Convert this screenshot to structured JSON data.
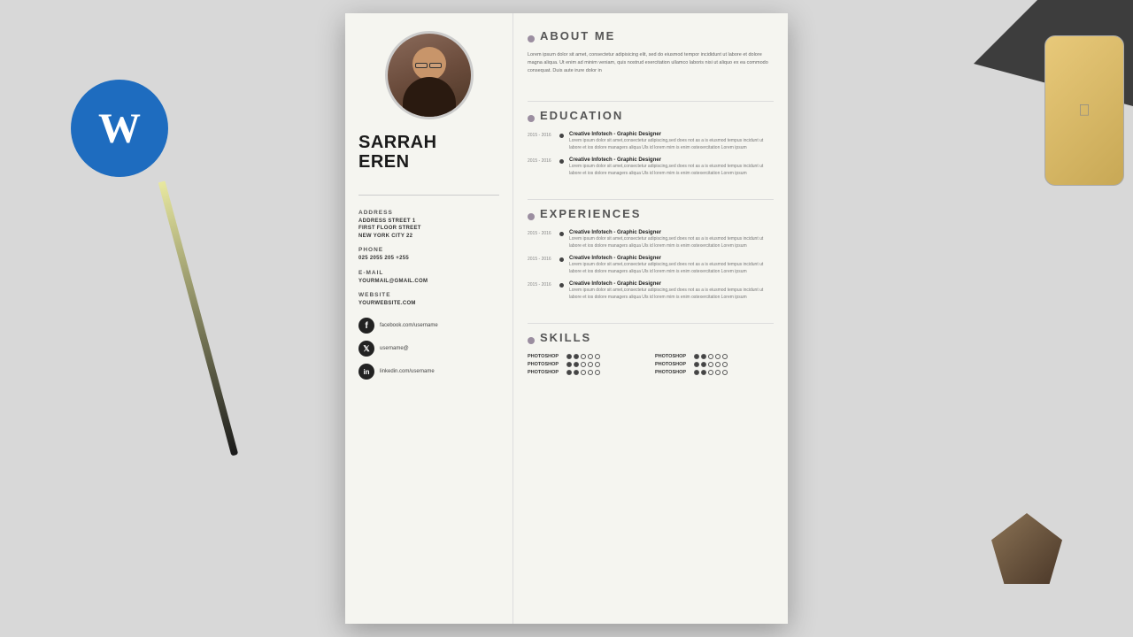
{
  "background": {
    "color": "#d8d8d8"
  },
  "word_icon": {
    "letter": "W"
  },
  "resume": {
    "name_line1": "SARRAH",
    "name_line2": "EREN",
    "address_label": "ADDRESS",
    "address_value": "ADDRESS STREET 1\nFIRST FLOOR STREET\nNEW YORK CITY 22",
    "phone_label": "PHONE",
    "phone_value": "025 2055 205 +255",
    "email_label": "E-MAIL",
    "email_value": "YOURMAIL@GMAIL.COM",
    "website_label": "WEBSITE",
    "website_value": "YOURWEBSITE.COM",
    "social": [
      {
        "icon": "f",
        "label": "facebook.com/username"
      },
      {
        "icon": "t",
        "label": "username@"
      },
      {
        "icon": "in",
        "label": "linkedin.com/username"
      }
    ],
    "about_title": "ABOUT ME",
    "about_text": "Lorem ipsum dolor sit amet, consectetur adipisicing elit, sed do eiusmod tempor incididunt ut labore et dolore magna aliqua. Ut enim ad minim veniam, quis nostrud exercitation ullamco laboris nisi ut aliquo ex ea commodo consequat. Duis aute irure dolor in",
    "education_title": "EDUCATION",
    "education_entries": [
      {
        "year": "2015 - 2016",
        "title": "Creative Infotech - Graphic Designer",
        "desc": "Lorem ipsum dolor sit amet,consectetur adipiscing,sed does not as a is eiusmod tempus incidunt ut labore et ios dolore managers aliqua Uls id lorem mim is enim ostexercitation Lorem ipsum"
      },
      {
        "year": "2015 - 2016",
        "title": "Creative Infotech - Graphic Designer",
        "desc": "Lorem ipsum dolor sit amet,consectetur adipiscing,sed does not as a is eiusmod tempus incidunt ut labore et ios dolore managers aliqua Uls id lorem mim is enim ostexercitation Lorem ipsum"
      }
    ],
    "experience_title": "EXPERIENCES",
    "experience_entries": [
      {
        "year": "2015 - 2016",
        "title": "Creative Infotech - Graphic Designer",
        "desc": "Lorem ipsum dolor sit amet,consectetur adipiscing,sed does not as a is eiusmod tempus incidunt ut labore et ios dolore managers aliqua Uls id lorem mim is enim ostexercitation Lorem ipsum"
      },
      {
        "year": "2015 - 2016",
        "title": "Creative Infotech - Graphic Designer",
        "desc": "Lorem ipsum dolor sit amet,consectetur adipiscing,sed does not as a is eiusmod tempus incidunt ut labore et ios dolore managers aliqua Uls id lorem mim is enim ostexercitation Lorem ipsum"
      },
      {
        "year": "2015 - 2016",
        "title": "Creative Infotech - Graphic Designer",
        "desc": "Lorem ipsum dolor sit amet,consectetur adipiscing,sed does not as a is eiusmod tempus incidunt ut labore et ios dolore managers aliqua Uls id lorem mim is enim ostexercitation Lorem ipsum"
      }
    ],
    "skills_title": "SKILLS",
    "skills": [
      {
        "name": "PHOTOSHOP",
        "level": 2
      },
      {
        "name": "PHOTOSHOP",
        "level": 2
      },
      {
        "name": "PHOTOSHOP",
        "level": 2
      },
      {
        "name": "PHOTOSHOP",
        "level": 2
      },
      {
        "name": "PHOTOSHOP",
        "level": 2
      },
      {
        "name": "PHOTOSHOP",
        "level": 2
      }
    ]
  }
}
